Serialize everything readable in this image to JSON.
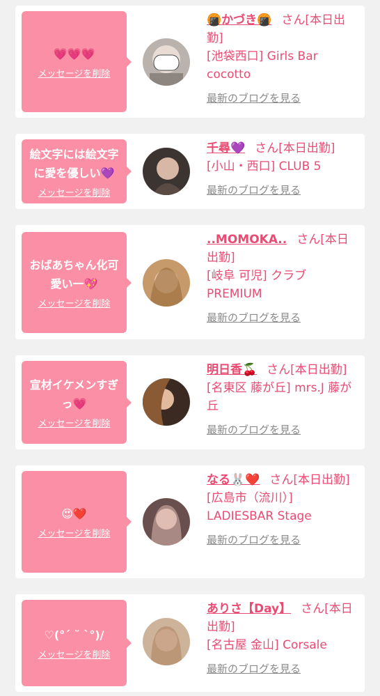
{
  "entries": [
    {
      "message": "💗💗💗",
      "delete_label": "メッセージを削除",
      "name": "🍘かづき🍘",
      "suffix": "さん[本日出勤]",
      "shop": "[池袋西口] Girls Bar cocotto",
      "blog_label": "最新のブログを見る"
    },
    {
      "message": "絵文字には絵文字に愛を優しい💜",
      "delete_label": "メッセージを削除",
      "name": "千尋💜",
      "suffix": "さん[本日出勤]",
      "shop": "[小山・西口] CLUB 5",
      "blog_label": "最新のブログを見る"
    },
    {
      "message": "おばあちゃん化可愛い一💖",
      "delete_label": "メッセージを削除",
      "name": "..MOMOKA..",
      "suffix": "さん[本日出勤]",
      "shop": "[岐阜 可児] クラブ PREMIUM",
      "blog_label": "最新のブログを見る"
    },
    {
      "message": "宣材イケメンすぎっ💗",
      "delete_label": "メッセージを削除",
      "name": "明日香🍒",
      "suffix": "さん[本日出勤]",
      "shop": "[名東区 藤が丘] mrs.J 藤が丘",
      "blog_label": "最新のブログを見る"
    },
    {
      "message": "😍❤️",
      "delete_label": "メッセージを削除",
      "name": "なる🐰❤️",
      "suffix": "さん[本日出勤]",
      "shop": "[広島市（流川）] LADIESBAR Stage",
      "blog_label": "最新のブログを見る"
    },
    {
      "message": "♡(°´ ˘ `°)/",
      "delete_label": "メッセージを削除",
      "name": "ありさ【Day】",
      "suffix": "さん[本日出勤]",
      "shop": "[名古屋 金山] Corsale",
      "blog_label": "最新のブログを見る"
    }
  ],
  "colors": {
    "background": "#f1f1f1",
    "card": "#ffffff",
    "bubble": "#fb8fa6",
    "accent": "#e94b73",
    "muted": "#8a8a8a"
  },
  "icons": [
    "avatar-photo"
  ]
}
